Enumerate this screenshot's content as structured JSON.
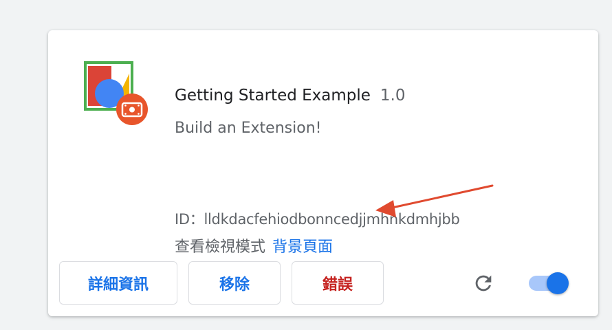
{
  "extension": {
    "name": "Getting Started Example",
    "version": "1.0",
    "description": "Build an Extension!",
    "id_line": "ID：lldkdacfehiodbonncedjjmhnkdmhjbb",
    "inspect_label": "查看檢視模式",
    "background_link": "背景頁面"
  },
  "buttons": {
    "details": "詳細資訊",
    "remove": "移除",
    "errors": "錯誤"
  },
  "toggle": {
    "enabled": true
  },
  "colors": {
    "link_blue": "#1a73e8",
    "error_red": "#c5221f",
    "arrow_red": "#e04a2f",
    "toggle_track": "#a8c7fa"
  },
  "icons": {
    "extension": "extension-puzzle-shapes-icon",
    "badge": "camera-badge-icon",
    "reload": "reload-icon"
  }
}
